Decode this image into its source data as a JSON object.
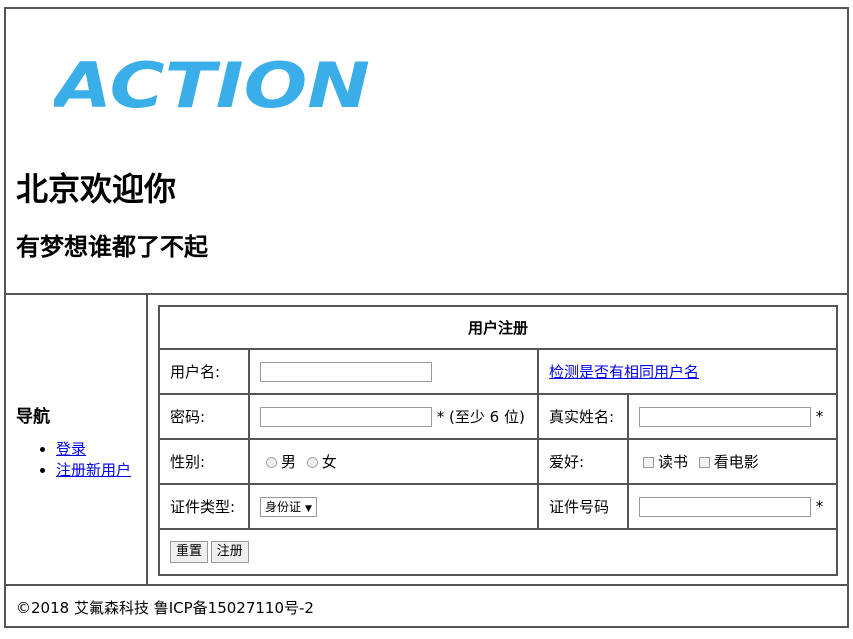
{
  "header": {
    "logo_text": "ACTION",
    "logo_color": "#3aaee8",
    "title": "北京欢迎你",
    "subtitle": "有梦想谁都了不起"
  },
  "nav": {
    "title": "导航",
    "links": [
      "登录",
      "注册新用户"
    ]
  },
  "form": {
    "title": "用户注册",
    "username": {
      "label": "用户名:",
      "value": "",
      "check_link": "检测是否有相同用户名"
    },
    "password": {
      "label": "密码:",
      "value": "",
      "hint": "* (至少 6 位)"
    },
    "realname": {
      "label": "真实姓名:",
      "value": "",
      "required": "*"
    },
    "gender": {
      "label": "性别:",
      "options": [
        "男",
        "女"
      ]
    },
    "hobby": {
      "label": "爱好:",
      "options": [
        "读书",
        "看电影"
      ]
    },
    "id_type": {
      "label": "证件类型:",
      "selected": "身份证"
    },
    "id_number": {
      "label": "证件号码",
      "value": "",
      "required": "*"
    },
    "buttons": {
      "reset": "重置",
      "submit": "注册"
    }
  },
  "footer": {
    "text": "©2018 艾氟森科技 鲁ICP备15027110号-2"
  }
}
